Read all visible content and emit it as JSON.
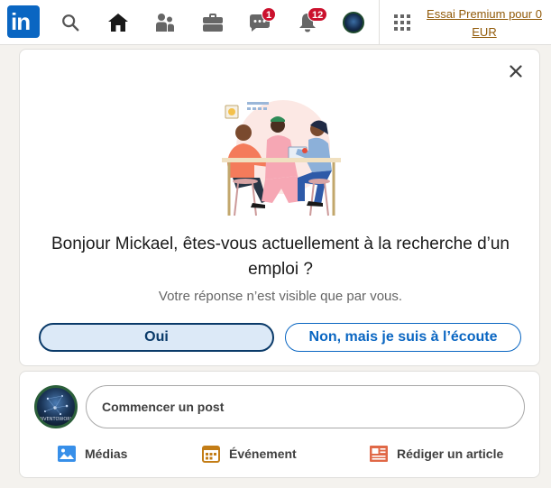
{
  "nav": {
    "logo_text": "in",
    "icons": [
      "search-icon",
      "home-icon",
      "network-icon",
      "briefcase-icon",
      "messaging-icon",
      "notifications-icon"
    ],
    "messaging_badge": "1",
    "notifications_badge": "12",
    "premium_label": "Essai Premium pour 0 EUR",
    "colors": {
      "brand": "#0a66c2",
      "badge": "#cb112d",
      "premium": "#915907"
    }
  },
  "job_prompt": {
    "question": "Bonjour Mickael, êtes-vous actuellement à la recherche d’un emploi ?",
    "note": "Votre réponse n’est visible que par vous.",
    "yes_label": "Oui",
    "no_label": "Non, mais je suis à l’écoute"
  },
  "share_box": {
    "placeholder": "Commencer un post",
    "avatar_text": "INVENTOWORK",
    "actions": [
      {
        "label": "Médias",
        "icon": "photo-icon",
        "color": "#378fe9"
      },
      {
        "label": "Événement",
        "icon": "calendar-icon",
        "color": "#c37d16"
      },
      {
        "label": "Rédiger un article",
        "icon": "article-icon",
        "color": "#e06847"
      }
    ]
  }
}
